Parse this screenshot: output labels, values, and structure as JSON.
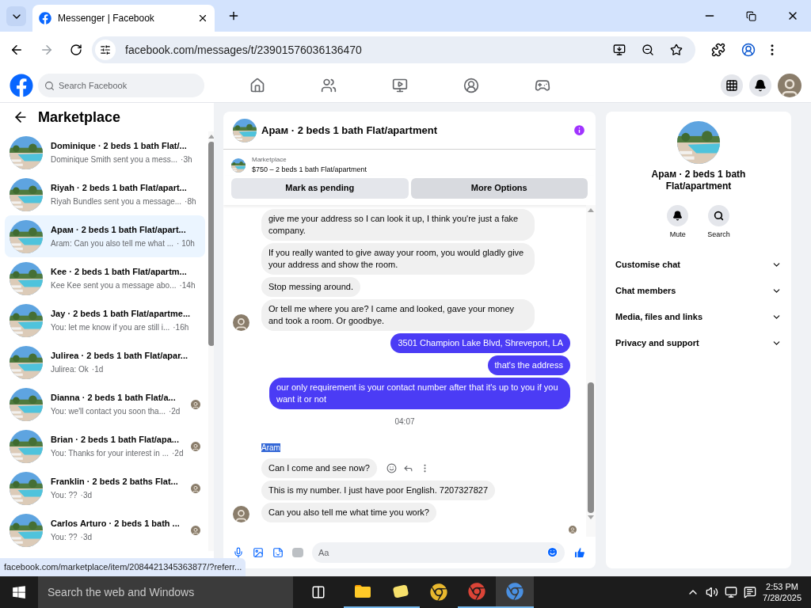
{
  "browser": {
    "tab_title": "Messenger | Facebook",
    "url": "facebook.com/messages/t/23901576036136470",
    "status_link": "facebook.com/marketplace/item/2084421345363877/?referr..."
  },
  "nav": {
    "search_placeholder": "Search Facebook",
    "tabs": [
      {
        "kind": "home",
        "selected": false
      },
      {
        "kind": "friends",
        "selected": false
      },
      {
        "kind": "video",
        "selected": false
      },
      {
        "kind": "groups",
        "selected": false
      },
      {
        "kind": "gaming",
        "selected": false
      }
    ]
  },
  "sidebar": {
    "title": "Marketplace",
    "conversations": [
      {
        "title": "Dominique · 2 beds 1 bath Flat/...",
        "preview": "Dominique Smith sent you a mess...",
        "time": "·3h",
        "seen": false,
        "selected": false
      },
      {
        "title": "Riyah · 2 beds 1 bath Flat/apart...",
        "preview": "Riyah Bundles sent you a message...",
        "time": "·8h",
        "seen": false,
        "selected": false
      },
      {
        "title": "Арам · 2 beds 1 bath Flat/apart...",
        "preview": "Aram: Can you also tell me what ...",
        "time": "· 10h",
        "seen": false,
        "selected": true
      },
      {
        "title": "Kee · 2 beds 1 bath Flat/apartm...",
        "preview": "Kee Kee sent you a message abo...",
        "time": "·14h",
        "seen": false,
        "selected": false
      },
      {
        "title": "Jay · 2 beds 1 bath Flat/apartme...",
        "preview": "You: let me know if you are still i...",
        "time": "·16h",
        "seen": false,
        "selected": false
      },
      {
        "title": "Julirea · 2 beds 1 bath Flat/apar...",
        "preview": "Julirea: Ok",
        "time": "·1d",
        "seen": false,
        "selected": false
      },
      {
        "title": "Dianna · 2 beds 1 bath Flat/a...",
        "preview": "You: we'll contact you soon tha...",
        "time": "·2d",
        "seen": true,
        "selected": false
      },
      {
        "title": "Brian · 2 beds 1 bath Flat/apa...",
        "preview": "You: Thanks for your interest in ...",
        "time": "·2d",
        "seen": true,
        "selected": false
      },
      {
        "title": "Franklin · 2 beds 2 baths Flat...",
        "preview": "You: ??",
        "time": "·3d",
        "seen": true,
        "selected": false
      },
      {
        "title": "Carlos Arturo · 2 beds 1 bath ...",
        "preview": "You: ??",
        "time": "·3d",
        "seen": true,
        "selected": false
      }
    ]
  },
  "chat": {
    "title": "Арам · 2 beds 1 bath Flat/apartment",
    "listing_source": "Marketplace",
    "listing": "$750 – 2 beds 1 bath Flat/apartment",
    "buttons": [
      "Mark as pending",
      "More Options"
    ],
    "messages": [
      {
        "kind": "incoming",
        "text": "give me your address so I can look it up, I think you're just a fake company.",
        "avatar": false,
        "actions": false
      },
      {
        "kind": "incoming",
        "text": "If you really wanted to give away your room, you would gladly give your address and show the room.",
        "avatar": false,
        "actions": false
      },
      {
        "kind": "incoming",
        "text": "Stop messing around.",
        "avatar": false,
        "actions": false
      },
      {
        "kind": "incoming",
        "text": "Or tell me where you are? I came and looked, gave your money and took a room. Or goodbye.",
        "avatar": true,
        "actions": false
      },
      {
        "kind": "outgoing",
        "text": "3501 Champion Lake Blvd, Shreveport, LA"
      },
      {
        "kind": "outgoing",
        "text": "that's the address"
      },
      {
        "kind": "outgoing",
        "text": "our only requirement is your contact number after that it's up to you if you want it or not"
      },
      {
        "kind": "time",
        "text": "04:07"
      },
      {
        "kind": "sender",
        "text": "Aram",
        "highlighted": true
      },
      {
        "kind": "incoming",
        "text": "Can I come and see now?",
        "avatar": false,
        "actions": true
      },
      {
        "kind": "incoming",
        "text": "This is my number. I just have poor English. 7207327827",
        "avatar": false,
        "actions": false
      },
      {
        "kind": "incoming",
        "text": "Can you also tell me what time you work?",
        "avatar": true,
        "actions": false
      }
    ],
    "composer_placeholder": "Aa"
  },
  "details": {
    "title": "Арам · 2 beds 1 bath Flat/apartment",
    "actions": [
      {
        "kind": "mute",
        "label": "Mute"
      },
      {
        "kind": "search",
        "label": "Search"
      }
    ],
    "sections": [
      {
        "label": "Customise chat",
        "expanded": false
      },
      {
        "label": "Chat members",
        "expanded": false
      },
      {
        "label": "Media, files and links",
        "expanded": false
      },
      {
        "label": "Privacy and support",
        "expanded": false
      }
    ]
  },
  "taskbar": {
    "search_placeholder": "Search the web and Windows",
    "time": "2:53 PM",
    "date": "7/28/2025"
  }
}
